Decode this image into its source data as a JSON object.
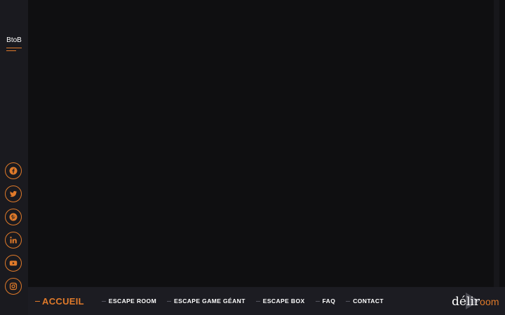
{
  "sidebar": {
    "menu_label": "BtoB",
    "socials": [
      {
        "icon": "facebook-icon"
      },
      {
        "icon": "twitter-icon"
      },
      {
        "icon": "pinterest-icon"
      },
      {
        "icon": "linkedin-icon"
      },
      {
        "icon": "youtube-icon"
      },
      {
        "icon": "instagram-icon"
      }
    ]
  },
  "nav": {
    "items": [
      {
        "label": "ACCUEIL",
        "active": true
      },
      {
        "label": "ESCAPE ROOM"
      },
      {
        "label": "ESCAPE GAME GÉANT"
      },
      {
        "label": "ESCAPE BOX"
      },
      {
        "label": "FAQ"
      },
      {
        "label": "CONTACT"
      }
    ]
  },
  "logo": {
    "text_main": "délir",
    "text_accent": "oom"
  },
  "colors": {
    "accent": "#e07a2a",
    "sidebar_bg": "#1a1a1f",
    "main_bg": "#0f0f11",
    "bottombar_bg": "#1c1c22"
  }
}
